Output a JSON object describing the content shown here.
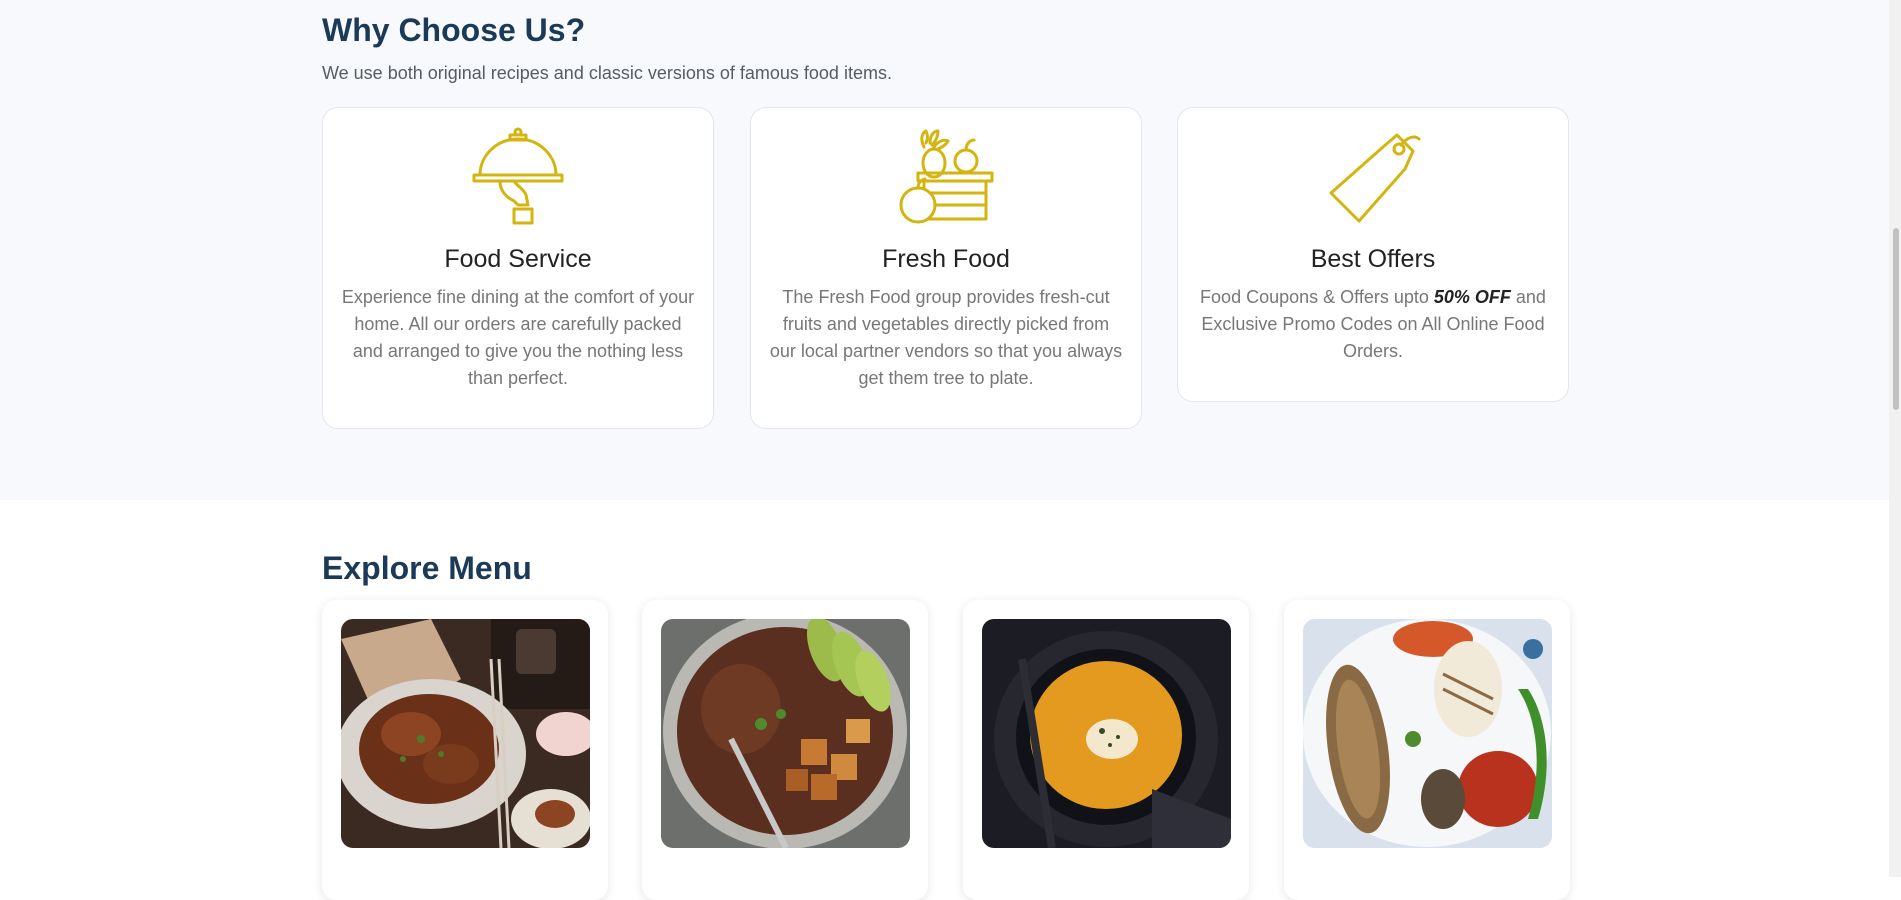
{
  "why": {
    "title": "Why Choose Us?",
    "subtitle": "We use both original recipes and classic versions of famous food items.",
    "accent_color": "#d4b40f",
    "features": [
      {
        "icon": "cloche-icon",
        "title": "Food Service",
        "text": "Experience fine dining at the comfort of your home. All our orders are carefully packed and arranged to give you the nothing less than perfect."
      },
      {
        "icon": "fruit-basket-icon",
        "title": "Fresh Food",
        "text": "The Fresh Food group provides fresh-cut fruits and vegetables directly picked from our local partner vendors so that you always get them tree to plate."
      },
      {
        "icon": "price-tag-icon",
        "title": "Best Offers",
        "text_before": "Food Coupons & Offers upto ",
        "text_emphasis": "50% OFF",
        "text_after": " and Exclusive Promo Codes on All Online Food Orders."
      }
    ]
  },
  "menu": {
    "title": "Explore Menu",
    "items": [
      {
        "image": "fried-chicken-photo"
      },
      {
        "image": "tofu-avocado-bowl-photo"
      },
      {
        "image": "pumpkin-soup-photo"
      },
      {
        "image": "grilled-seafood-platter-photo"
      }
    ]
  }
}
